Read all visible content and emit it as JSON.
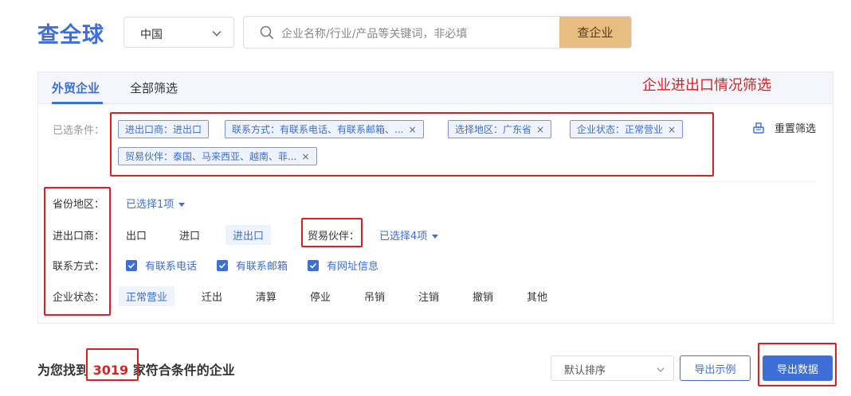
{
  "header": {
    "logo": "查全球",
    "country": "中国",
    "search_placeholder": "企业名称/行业/产品等关键词，非必填",
    "search_button": "查企业"
  },
  "tabs": [
    {
      "label": "外贸企业",
      "active": true
    },
    {
      "label": "全部筛选",
      "active": false
    }
  ],
  "annotation_title": "企业进出口情况筛选",
  "selected": {
    "label": "已选条件：",
    "chips": [
      {
        "text": "进出口商：进出口",
        "closable": false
      },
      {
        "text": "联系方式：有联系电话、有联系邮箱、...",
        "closable": true
      },
      {
        "text": "选择地区：广东省",
        "closable": true
      },
      {
        "text": "企业状态：正常营业",
        "closable": true
      },
      {
        "text": "贸易伙伴：泰国、马来西亚、越南、菲...",
        "closable": true
      }
    ],
    "close_glyph": "×",
    "reset_label": "重置筛选"
  },
  "filters": {
    "province": {
      "label": "省份地区：",
      "value": "已选择1项"
    },
    "trader": {
      "label": "进出口商：",
      "options": [
        "出口",
        "进口",
        "进出口"
      ],
      "selected": "进出口",
      "partner_label": "贸易伙伴：",
      "partner_value": "已选择4项"
    },
    "contact": {
      "label": "联系方式：",
      "options": [
        "有联系电话",
        "有联系邮箱",
        "有网址信息"
      ]
    },
    "status": {
      "label": "企业状态：",
      "options": [
        "正常营业",
        "迁出",
        "清算",
        "停业",
        "吊销",
        "注销",
        "撤销",
        "其他"
      ],
      "selected": "正常营业"
    }
  },
  "result": {
    "prefix": "为您找到",
    "count": "3019",
    "suffix": "家符合条件的企业"
  },
  "sort": {
    "value": "默认排序"
  },
  "buttons": {
    "export_sample": "导出示例",
    "export_data": "导出数据"
  },
  "colors": {
    "brand": "#3d6fd6",
    "search_button": "#e8bd82",
    "annotation": "#e02020"
  }
}
